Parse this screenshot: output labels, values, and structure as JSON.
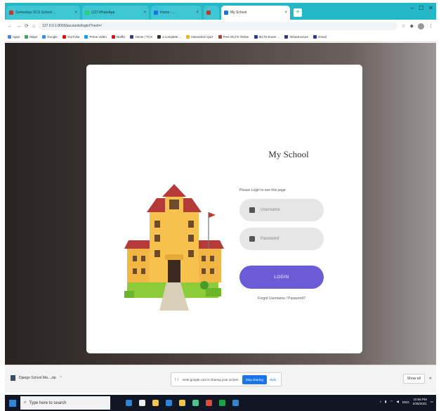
{
  "window": {
    "tabs": [
      {
        "label": "Somedays SCS School ...",
        "fav": "#c0392b",
        "active": false
      },
      {
        "label": "(12) WhatsApp",
        "fav": "#25d366",
        "active": false
      },
      {
        "label": "Home - ...",
        "fav": "#1a73e8",
        "active": false
      },
      {
        "label": "",
        "fav": "#c0392b",
        "active": false
      },
      {
        "label": "My School",
        "fav": "#1a73e8",
        "active": true
      }
    ],
    "close_glyph": "×",
    "new_tab_glyph": "+",
    "controls": [
      "–",
      "☐",
      "✕"
    ]
  },
  "toolbar": {
    "url": "127.0.0.1:8000/accounts/login/?next=/",
    "back_glyph": "←",
    "forward_glyph": "→",
    "reload_glyph": "⟳",
    "home_glyph": "⌂"
  },
  "bookmarks": [
    {
      "label": "Apps",
      "color": "#4285f4"
    },
    {
      "label": "Maps",
      "color": "#34a853"
    },
    {
      "label": "Google",
      "color": "#4285f4"
    },
    {
      "label": "YouTube",
      "color": "#ff0000"
    },
    {
      "label": "Prime Video",
      "color": "#1a98ff"
    },
    {
      "label": "Netflix",
      "color": "#e50914"
    },
    {
      "label": "Home | TCS",
      "color": "#2b3a8c"
    },
    {
      "label": "A complete ...",
      "color": "#333333"
    },
    {
      "label": "Interactive Quiz",
      "color": "#f4b400"
    },
    {
      "label": "Free IELTS Online",
      "color": "#c0392b"
    },
    {
      "label": "IELTS Exam ...",
      "color": "#2b3a8c"
    },
    {
      "label": "Infrastructure",
      "color": "#2b3a8c"
    },
    {
      "label": "Gmail",
      "color": "#2b3a8c"
    }
  ],
  "login": {
    "title": "My School",
    "intro": "Please Login to see this page",
    "username_placeholder": "Username",
    "password_placeholder": "Password",
    "login_label": "LOGIN",
    "forgot_label": "Forgot Username / Password?"
  },
  "downloads": {
    "file_label": "Django School Ma....zip",
    "share_text": "meet.google.com is sharing your screen.",
    "stop_label": "Stop sharing",
    "hide_label": "Hide",
    "show_all_label": "Show all",
    "close_glyph": "✕"
  },
  "taskbar": {
    "search_placeholder": "Type here to search",
    "icons": [
      "#2f86d6",
      "#eeeeee",
      "#f4c542",
      "#2f86d6",
      "#f4c542",
      "#4cc38a",
      "#e04a3b",
      "#1aa34a",
      "#2f86d6"
    ],
    "time": "10:56 PM",
    "date": "2/26/2021",
    "lang": "ENG"
  }
}
